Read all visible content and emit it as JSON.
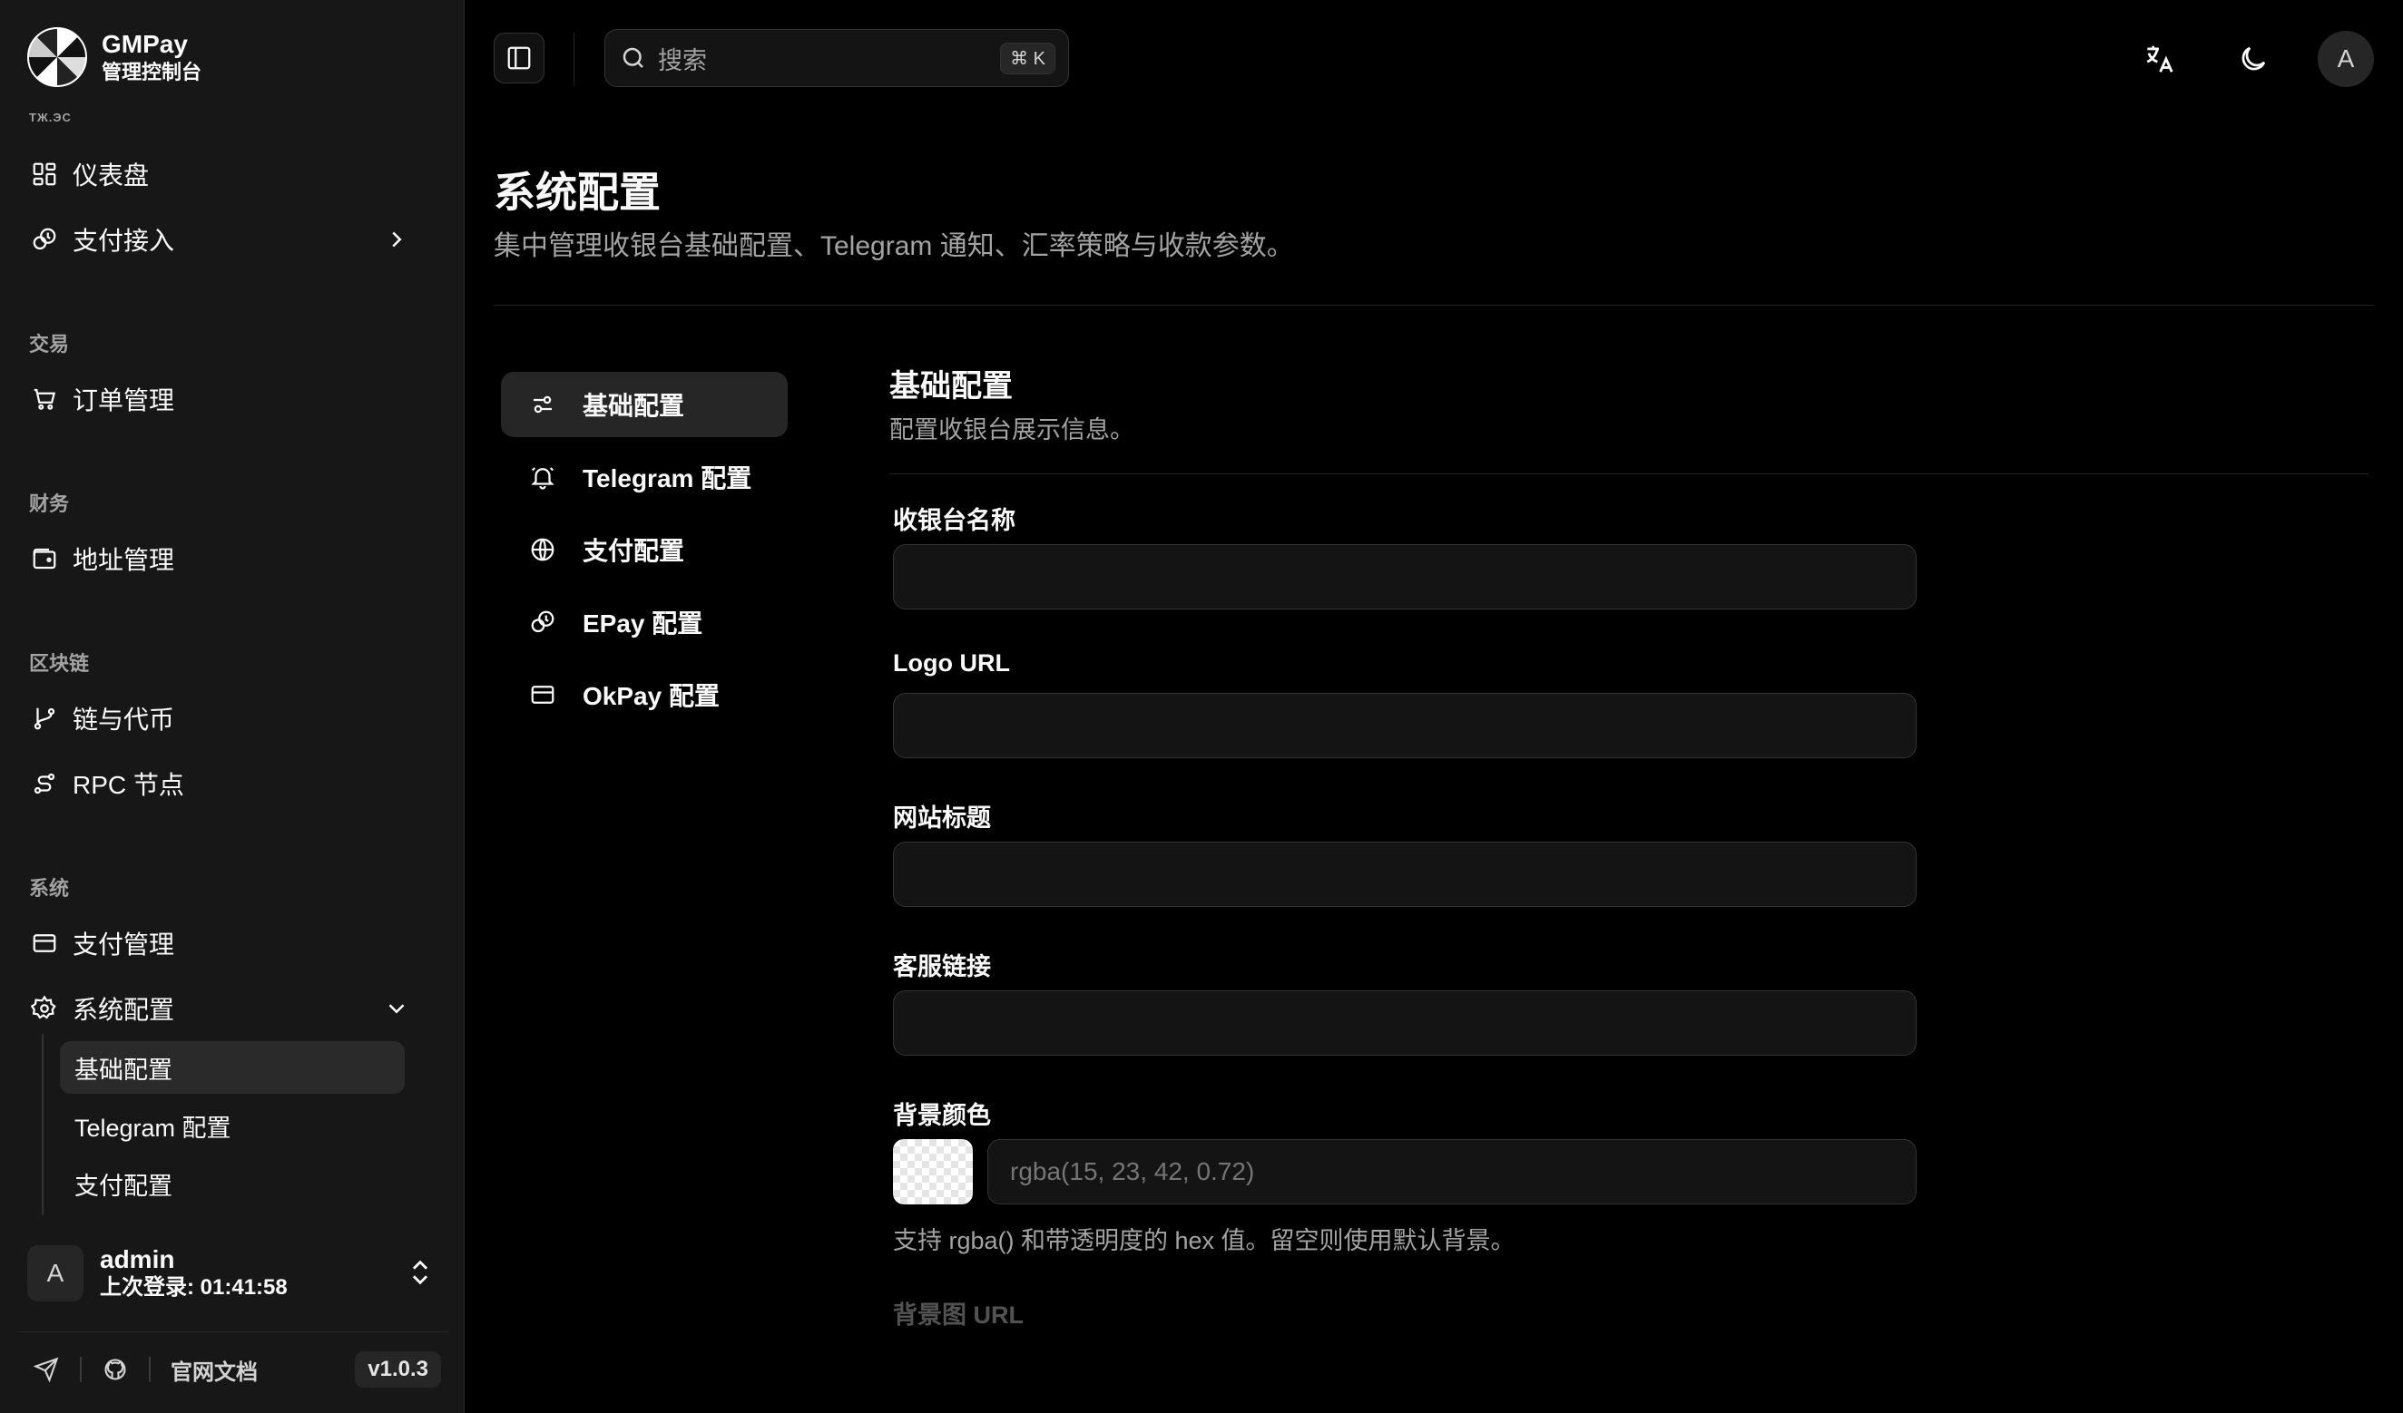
{
  "brand": {
    "name": "GMPay",
    "subtitle": "管理控制台",
    "cut_label": "TЖ.ЭС"
  },
  "sidebar": {
    "items": [
      {
        "label": "仪表盘"
      },
      {
        "label": "支付接入"
      }
    ],
    "groups": [
      {
        "label": "交易",
        "items": [
          {
            "label": "订单管理"
          }
        ]
      },
      {
        "label": "财务",
        "items": [
          {
            "label": "地址管理"
          }
        ]
      },
      {
        "label": "区块链",
        "items": [
          {
            "label": "链与代币"
          },
          {
            "label": "RPC 节点"
          }
        ]
      },
      {
        "label": "系统",
        "items": [
          {
            "label": "支付管理"
          },
          {
            "label": "系统配置"
          }
        ]
      }
    ],
    "sub_items": [
      {
        "label": "基础配置"
      },
      {
        "label": "Telegram 配置"
      },
      {
        "label": "支付配置"
      }
    ]
  },
  "user": {
    "avatar": "A",
    "name": "admin",
    "last_login": "上次登录: 01:41:58"
  },
  "footer": {
    "docs": "官网文档",
    "version": "v1.0.3"
  },
  "header": {
    "search_placeholder": "搜索",
    "shortcut": "⌘ K",
    "avatar": "A"
  },
  "page": {
    "title": "系统配置",
    "description": "集中管理收银台基础配置、Telegram 通知、汇率策略与收款参数。"
  },
  "config_nav": [
    {
      "label": "基础配置",
      "icon": "sliders-icon"
    },
    {
      "label": "Telegram 配置",
      "icon": "bell-icon"
    },
    {
      "label": "支付配置",
      "icon": "globe-icon"
    },
    {
      "label": "EPay 配置",
      "icon": "coins-icon"
    },
    {
      "label": "OkPay 配置",
      "icon": "card-icon"
    }
  ],
  "section": {
    "title": "基础配置",
    "description": "配置收银台展示信息。",
    "fields": [
      {
        "label": "收银台名称",
        "value": ""
      },
      {
        "label": "Logo URL",
        "value": ""
      },
      {
        "label": "网站标题",
        "value": ""
      },
      {
        "label": "客服链接",
        "value": ""
      }
    ],
    "bg_color": {
      "label": "背景颜色",
      "placeholder": "rgba(15, 23, 42, 0.72)",
      "hint": "支持 rgba() 和带透明度的 hex 值。留空则使用默认背景。"
    },
    "bg_image_label": "背景图 URL"
  },
  "colors": {
    "background": "#000000",
    "sidebar": "#171717",
    "text": "#fafafa",
    "muted": "#a3a3a3"
  }
}
